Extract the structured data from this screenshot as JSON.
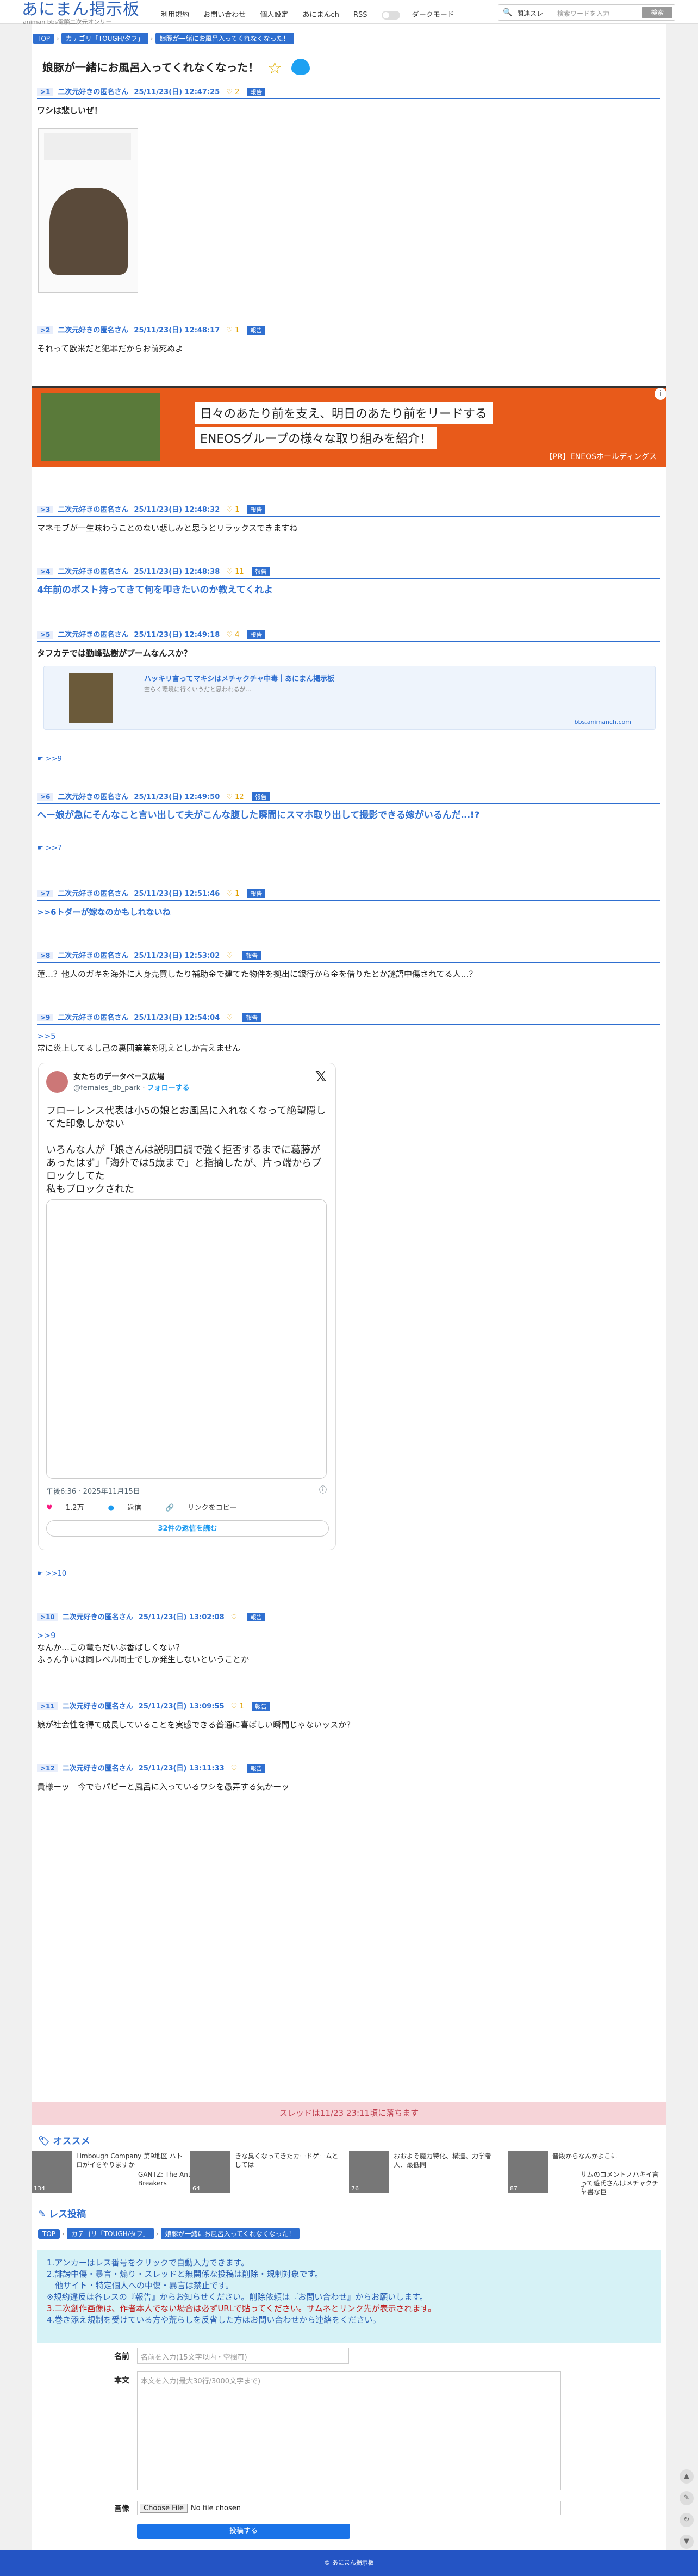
{
  "header": {
    "logo": "あにまん掲示板",
    "logo_sub": "animan bbs電脳二次元オンリー",
    "nav": [
      "利用規約",
      "お問い合わせ",
      "個人設定",
      "あにまんch",
      "RSS"
    ],
    "dark_mode": "ダークモード",
    "search_sort": "関連スレ",
    "search_placeholder": "検索ワードを入力",
    "search_button": "検索"
  },
  "breadcrumb": {
    "top": "TOP",
    "category": "カテゴリ「TOUGH/タフ」",
    "thread": "娘豚が一緒にお風呂入ってくれなくなった！"
  },
  "thread_title": "娘豚が一緒にお風呂入ってくれなくなった！",
  "posts": [
    {
      "num": ">1",
      "name": "二次元好きの匿名さん",
      "date": "25/11/23(日) 12:47:25",
      "likes": "2",
      "report": "報告",
      "body": "ワシは悲しいぜ！"
    },
    {
      "num": ">2",
      "name": "二次元好きの匿名さん",
      "date": "25/11/23(日) 12:48:17",
      "likes": "1",
      "report": "報告",
      "body": "それって欧米だと犯罪だからお前死ぬよ"
    },
    {
      "num": ">3",
      "name": "二次元好きの匿名さん",
      "date": "25/11/23(日) 12:48:32",
      "likes": "1",
      "report": "報告",
      "body": "マネモブが一生味わうことのない悲しみと思うとリラックスできますね"
    },
    {
      "num": ">4",
      "name": "二次元好きの匿名さん",
      "date": "25/11/23(日) 12:48:38",
      "likes": "11",
      "report": "報告",
      "body": "4年前のポスト持ってきて何を叩きたいのか教えてくれよ"
    },
    {
      "num": ">5",
      "name": "二次元好きの匿名さん",
      "date": "25/11/23(日) 12:49:18",
      "likes": "4",
      "report": "報告",
      "body": "タフカテでは勤峰弘樹がブームなんスか？",
      "reply": ">>9"
    },
    {
      "num": ">6",
      "name": "二次元好きの匿名さん",
      "date": "25/11/23(日) 12:49:50",
      "likes": "12",
      "report": "報告",
      "body": "へー娘が急にそんなこと言い出して夫がこんな腹した瞬間にスマホ取り出して撮影できる嫁がいるんだ…!?",
      "reply": ">>7"
    },
    {
      "num": ">7",
      "name": "二次元好きの匿名さん",
      "date": "25/11/23(日) 12:51:46",
      "likes": "1",
      "report": "報告",
      "body": ">>6トダーが嫁なのかもしれないね"
    },
    {
      "num": ">8",
      "name": "二次元好きの匿名さん",
      "date": "25/11/23(日) 12:53:02",
      "likes": "",
      "report": "報告",
      "body": "蓮…？他人のガキを海外に人身売買したり補助金で建てた物件を拠出に銀行から金を借りたとか謎語中傷されてる人…？"
    },
    {
      "num": ">9",
      "name": "二次元好きの匿名さん",
      "date": "25/11/23(日) 12:54:04",
      "likes": "",
      "report": "報告",
      "body_link": ">>5",
      "body": "常に炎上してるし己の裏団業業を吼えとしか言えません",
      "reply": ">>10"
    },
    {
      "num": ">10",
      "name": "二次元好きの匿名さん",
      "date": "25/11/23(日) 13:02:08",
      "likes": "",
      "report": "報告",
      "body_link": ">>9",
      "body": "なんか…この竜もだいぶ香ばしくない？\nふぅん争いは同レベル同士でしか発生しないということか"
    },
    {
      "num": ">11",
      "name": "二次元好きの匿名さん",
      "date": "25/11/23(日) 13:09:55",
      "likes": "1",
      "report": "報告",
      "body": "娘が社会性を得て成長していることを実感できる普通に喜ばしい瞬間じゃないッスか？"
    },
    {
      "num": ">12",
      "name": "二次元好きの匿名さん",
      "date": "25/11/23(日) 13:11:33",
      "likes": "",
      "report": "報告",
      "body": "貴様ーッ　今でもパピーと風呂に入っているワシを愚弄する気かーッ"
    }
  ],
  "ad": {
    "line1": "日々のあたり前を支え、明日のあたり前をリードする",
    "line2": "ENEOSグループの様々な取り組みを紹介！",
    "source": "【PR】ENEOSホールディングス",
    "close": "i"
  },
  "link_card": {
    "title": "ハッキリ言ってマキシはメチャクチャ中毒｜あにまん掲示板",
    "desc": "空らく環境に行くいうだと思われるが…",
    "domain": "bbs.animanch.com"
  },
  "tweet": {
    "name": "女たちのデータベース広場",
    "handle": "@females_db_park",
    "follow": "フォローする",
    "text": "フローレンス代表は小5の娘とお風呂に入れなくなって絶望隠してた印象しかない\n\nいろんな人が「娘さんは説明口調で強く拒否するまでに葛藤があったはず」「海外では5歳まで」と指摘したが、片っ端からブロックしてた\n私もブロックされた",
    "time": "午後6:36 · 2025年11月15日",
    "likes": "1.2万",
    "reply": "返信",
    "copy": "リンクをコピー",
    "read_replies": "32件の返信を読む"
  },
  "closed_notice": "スレッドは11/23 23:11頃に落ちます",
  "recommend": {
    "heading": "オススメ",
    "items": [
      {
        "title": "Limbough Company 第9地区 ハトロがイをやりますか",
        "count": "134"
      },
      {
        "title": "GANTZ: The Ant Breakers",
        "count": "64"
      },
      {
        "title": "きな臭くなってきたカードゲームとしては",
        "count": ""
      },
      {
        "title": "おおよそ魔力特化、構造、力学者人、最低同",
        "count": "76"
      },
      {
        "title": "普段からなんかよこに",
        "count": "87"
      },
      {
        "title": "サムのコメントノハキイ言って遊氏さんはメチャクチャ書な巨",
        "count": "7"
      }
    ]
  },
  "reply_section": {
    "heading": "レス投稿",
    "notice": [
      "1.アンカーはレス番号をクリックで自動入力できます。",
      "2.誹謗中傷・暴言・煽り・スレッドと無関係な投稿は削除・規制対象です。",
      "　他サイト・特定個人への中傷・暴言は禁止です。",
      "※規約違反は各レスの『報告』からお知らせください。削除依頼は『お問い合わせ』からお願いします。",
      "3.二次創作画像は、作者本人でない場合は必ずURLで貼ってください。サムネとリンク先が表示されます。",
      "4.巻き添え規制を受けている方や荒らしを反省した方はお問い合わせから連絡をください。"
    ],
    "name_label": "名前",
    "name_placeholder": "名前を入力(15文字以内・空欄可)",
    "body_label": "本文",
    "body_placeholder": "本文を入力(最大30行/3000文字まで)",
    "image_label": "画像",
    "file_button": "Choose File",
    "file_status": "No file chosen",
    "submit": "投稿する"
  },
  "footer": "© あにまん掲示板"
}
